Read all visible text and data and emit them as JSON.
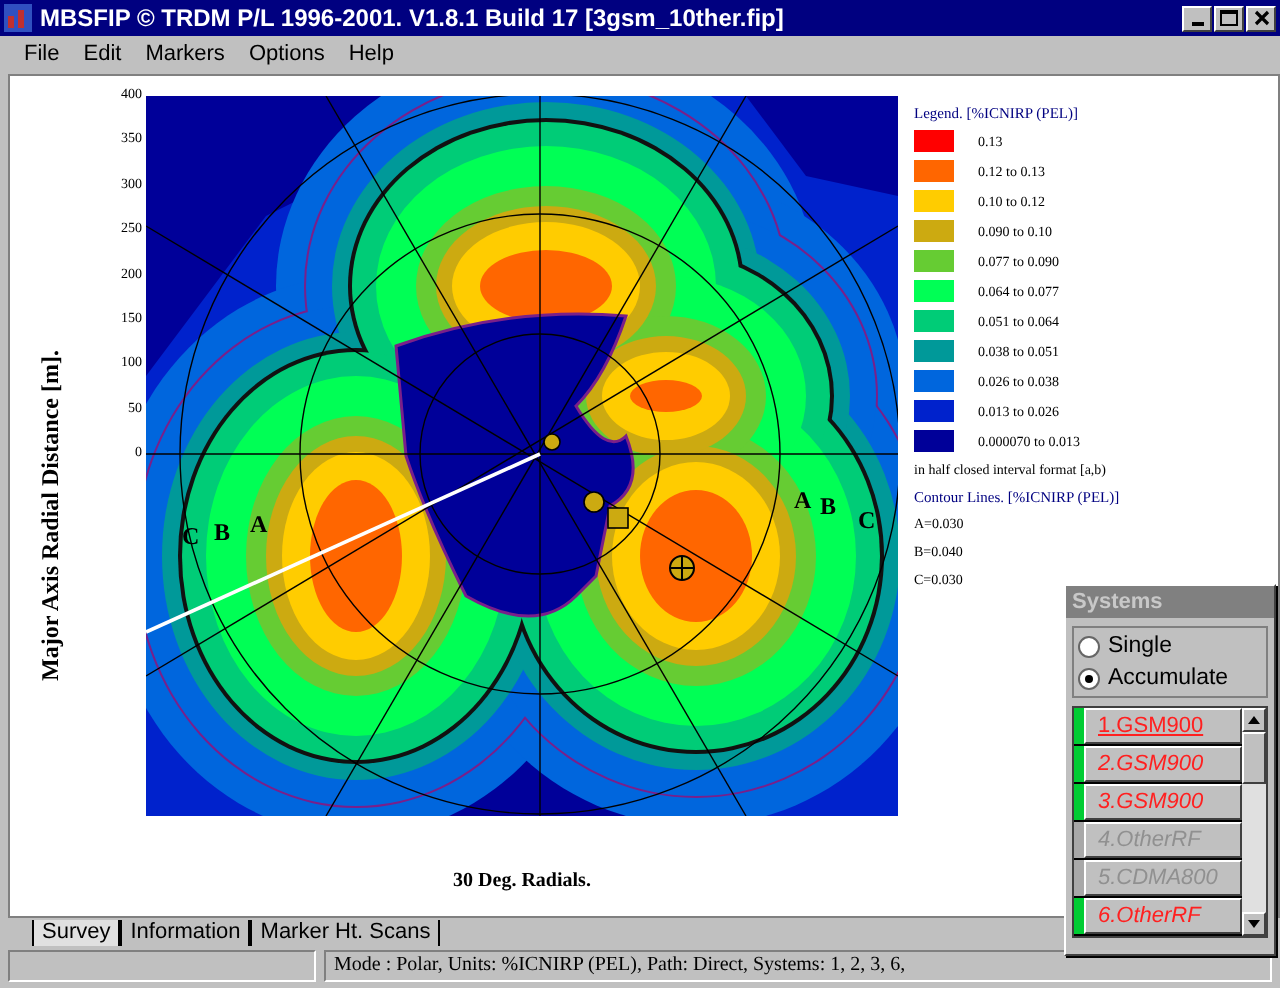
{
  "window": {
    "title": "MBSFIP © TRDM P/L 1996-2001. V1.8.1 Build 17 [3gsm_10ther.fip]"
  },
  "menu": [
    "File",
    "Edit",
    "Markers",
    "Options",
    "Help"
  ],
  "plot": {
    "ylabel": "Major Axis Radial Distance [m].",
    "yticks": [
      "400",
      "350",
      "300",
      "250",
      "200",
      "150",
      "100",
      "50",
      "0"
    ],
    "xlabel": "30 Deg. Radials.",
    "contour_labels_left": [
      "C",
      "B",
      "A"
    ],
    "contour_labels_right": [
      "A",
      "B",
      "C"
    ]
  },
  "legend": {
    "title": "Legend. [%ICNIRP (PEL)]",
    "items": [
      {
        "label": "0.13",
        "color": "#ff0000"
      },
      {
        "label": "0.12 to 0.13",
        "color": "#ff6600"
      },
      {
        "label": "0.10 to 0.12",
        "color": "#ffcc00"
      },
      {
        "label": "0.090 to 0.10",
        "color": "#ccaa11"
      },
      {
        "label": "0.077 to 0.090",
        "color": "#66cc33"
      },
      {
        "label": "0.064 to 0.077",
        "color": "#00ff55"
      },
      {
        "label": "0.051 to 0.064",
        "color": "#00cc77"
      },
      {
        "label": "0.038 to 0.051",
        "color": "#009999"
      },
      {
        "label": "0.026 to 0.038",
        "color": "#0066dd"
      },
      {
        "label": "0.013 to 0.026",
        "color": "#0022cc"
      },
      {
        "label": "0.000070 to 0.013",
        "color": "#000099"
      }
    ],
    "note": "in half closed interval format [a,b)",
    "contour_title": "Contour Lines. [%ICNIRP (PEL)]",
    "contours": [
      "A=0.030",
      "B=0.040",
      "C=0.030"
    ]
  },
  "tabs": [
    {
      "label": "Survey",
      "selected": true
    },
    {
      "label": "Information",
      "selected": false
    },
    {
      "label": "Marker Ht. Scans",
      "selected": false
    }
  ],
  "status_bar": "Mode : Polar, Units: %ICNIRP (PEL),  Path: Direct, Systems: 1, 2, 3, 6,",
  "systems": {
    "title": "Systems",
    "modes": [
      {
        "label": "Single",
        "selected": false
      },
      {
        "label": "Accumulate",
        "selected": true
      }
    ],
    "items": [
      {
        "label": "1.GSM900",
        "enabled": true,
        "selected": true
      },
      {
        "label": "2.GSM900",
        "enabled": true,
        "selected": false
      },
      {
        "label": "3.GSM900",
        "enabled": true,
        "selected": false
      },
      {
        "label": "4.OtherRF",
        "enabled": false,
        "selected": false
      },
      {
        "label": "5.CDMA800",
        "enabled": false,
        "selected": false
      },
      {
        "label": "6.OtherRF",
        "enabled": true,
        "selected": false
      }
    ]
  }
}
